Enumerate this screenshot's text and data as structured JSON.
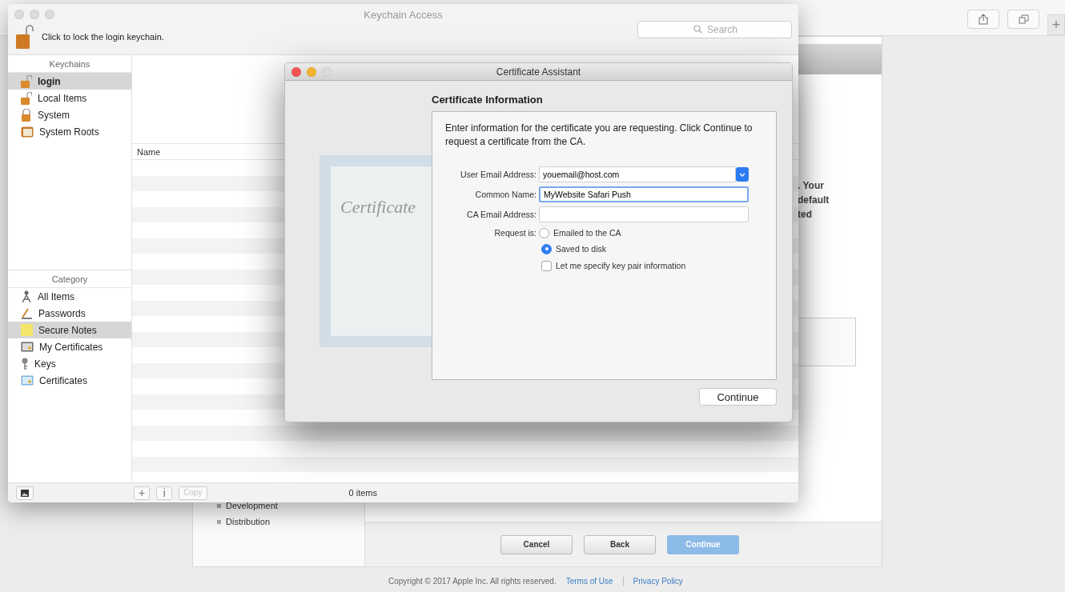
{
  "browser": {
    "new_tab": "+"
  },
  "web_page": {
    "nav_items": [
      "Development",
      "Distribution"
    ],
    "partial_text_lines": [
      ". Your",
      "default",
      "ted"
    ],
    "buttons": [
      {
        "label": "Cancel",
        "kind": "default"
      },
      {
        "label": "Back",
        "kind": "default"
      },
      {
        "label": "Continue",
        "kind": "primary"
      }
    ],
    "footer": {
      "copyright": "Copyright © 2017 Apple Inc. All rights reserved.",
      "links": [
        "Terms of Use",
        "Privacy Policy"
      ]
    }
  },
  "keychain_window": {
    "title": "Keychain Access",
    "lock_text": "Click to lock the login keychain.",
    "search": {
      "placeholder": "Search"
    },
    "keychains_header": "Keychains",
    "keychains": [
      {
        "label": "login",
        "selected": true
      },
      {
        "label": "Local Items",
        "selected": false
      },
      {
        "label": "System",
        "selected": false
      },
      {
        "label": "System Roots",
        "selected": false
      }
    ],
    "category_header": "Category",
    "categories": [
      {
        "label": "All Items",
        "selected": false
      },
      {
        "label": "Passwords",
        "selected": false
      },
      {
        "label": "Secure Notes",
        "selected": true
      },
      {
        "label": "My Certificates",
        "selected": false
      },
      {
        "label": "Keys",
        "selected": false
      },
      {
        "label": "Certificates",
        "selected": false
      }
    ],
    "table": {
      "columns": [
        "Name"
      ]
    },
    "toolbar_buttons": [
      {
        "label": "+",
        "disabled": false
      },
      {
        "label": "i",
        "disabled": false
      },
      {
        "label": "Copy",
        "disabled": true
      }
    ],
    "status": "0 items"
  },
  "dialog": {
    "title": "Certificate Assistant",
    "art_text": "Certificate",
    "heading": "Certificate Information",
    "intro": "Enter information for the certificate you are requesting. Click Continue to request a certificate from the CA.",
    "fields": [
      {
        "label": "User Email Address:",
        "value": "youemail@host.com",
        "kind": "combo",
        "focused": false
      },
      {
        "label": "Common Name:",
        "value": "MyWebsite Safari Push",
        "kind": "text",
        "focused": true
      },
      {
        "label": "CA Email Address:",
        "kind": "text",
        "focused": false
      }
    ],
    "request_label": "Request is:",
    "request_options": [
      {
        "label": "Emailed to the CA",
        "selected": false
      },
      {
        "label": "Saved to disk",
        "selected": true
      }
    ],
    "key_pair": {
      "label": "Let me specify key pair information",
      "checked": false
    },
    "button": "Continue"
  }
}
